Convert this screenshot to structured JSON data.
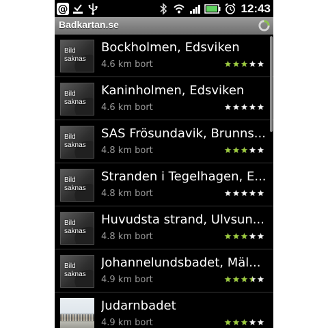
{
  "status_bar": {
    "time": "12:43",
    "left_icons": [
      "at-sign-icon",
      "download-complete-icon",
      "usb-icon"
    ],
    "right_icons": [
      "bluetooth-icon",
      "wifi-icon",
      "signal-icon",
      "battery-icon",
      "alarm-icon"
    ]
  },
  "app": {
    "title": "Badkartan.se",
    "accent": "#8bc34a"
  },
  "beaches": [
    {
      "name": "Bockholmen, Edsviken",
      "distance": "4.6 km bort",
      "rating": 3,
      "thumb": "Bild\nsaknas",
      "has_photo": false
    },
    {
      "name": "Kaninholmen, Edsviken",
      "distance": "4.6 km bort",
      "rating": 0,
      "thumb": "Bild\nsaknas",
      "has_photo": false
    },
    {
      "name": "SAS Frösundavik, Brunns...",
      "distance": "4.8 km bort",
      "rating": 3,
      "thumb": "Bild\nsaknas",
      "has_photo": false
    },
    {
      "name": "Stranden i Tegelhagen, E...",
      "distance": "4.8 km bort",
      "rating": 0,
      "thumb": "Bild\nsaknas",
      "has_photo": false
    },
    {
      "name": "Huvudsta strand, Ulvsun...",
      "distance": "4.8 km bort",
      "rating": 3,
      "thumb": "Bild\nsaknas",
      "has_photo": false
    },
    {
      "name": "Johannelundsbadet, Mäl...",
      "distance": "4.9 km bort",
      "rating": 3.5,
      "thumb": "Bild\nsaknas",
      "has_photo": false
    },
    {
      "name": "Judarnbadet",
      "distance": "4.9 km bort",
      "rating": 3,
      "thumb": "",
      "has_photo": true
    }
  ],
  "colors": {
    "star_on": "#9ccc3c",
    "star_off": "#f2f2f2"
  }
}
